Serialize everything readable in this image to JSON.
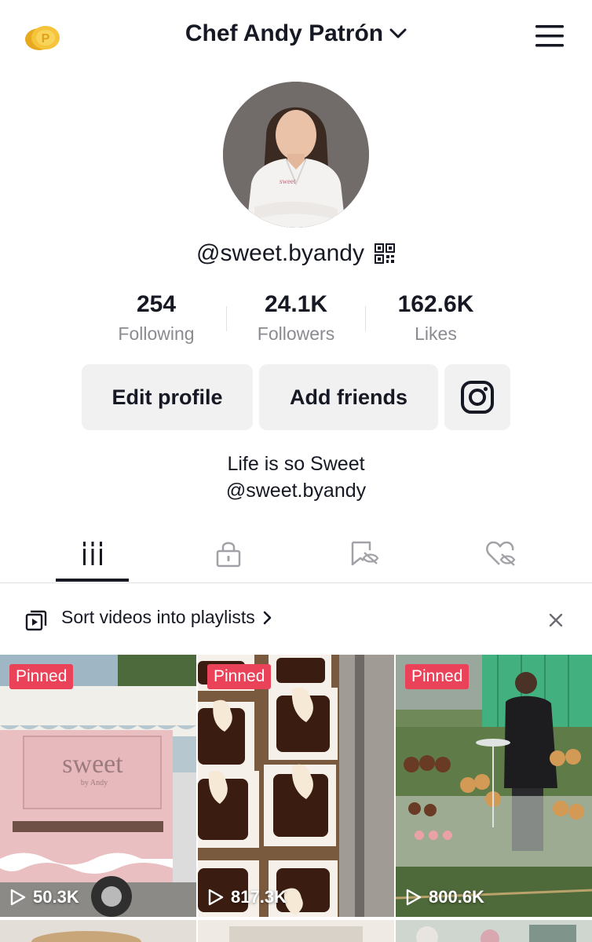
{
  "header": {
    "title": "Chef Andy Patrón",
    "coin_icon": "coins-icon",
    "dropdown_icon": "chevron-down-icon",
    "menu_icon": "hamburger-menu-icon"
  },
  "profile": {
    "username": "@sweet.byandy",
    "qr_icon": "qr-code-icon",
    "stats": [
      {
        "value": "254",
        "label": "Following"
      },
      {
        "value": "24.1K",
        "label": "Followers"
      },
      {
        "value": "162.6K",
        "label": "Likes"
      }
    ],
    "buttons": {
      "edit": "Edit profile",
      "add": "Add friends",
      "instagram_icon": "instagram-icon"
    },
    "bio": {
      "line1": "Life is so Sweet",
      "line2": "@sweet.byandy"
    }
  },
  "tabs": [
    {
      "icon": "videos-grid-icon",
      "active": true
    },
    {
      "icon": "private-lock-icon",
      "active": false
    },
    {
      "icon": "saved-hidden-icon",
      "active": false
    },
    {
      "icon": "liked-hidden-icon",
      "active": false
    }
  ],
  "playlist_banner": {
    "text": "Sort videos into playlists",
    "icon": "playlist-icon",
    "close_icon": "close-icon"
  },
  "videos": [
    {
      "pinned_label": "Pinned",
      "views": "50.3K"
    },
    {
      "pinned_label": "Pinned",
      "views": "817.3K"
    },
    {
      "pinned_label": "Pinned",
      "views": "800.6K"
    }
  ],
  "colors": {
    "text": "#161823",
    "secondary": "#8a8b91",
    "pinned": "#ea4359",
    "button_bg": "#f1f1f2"
  }
}
